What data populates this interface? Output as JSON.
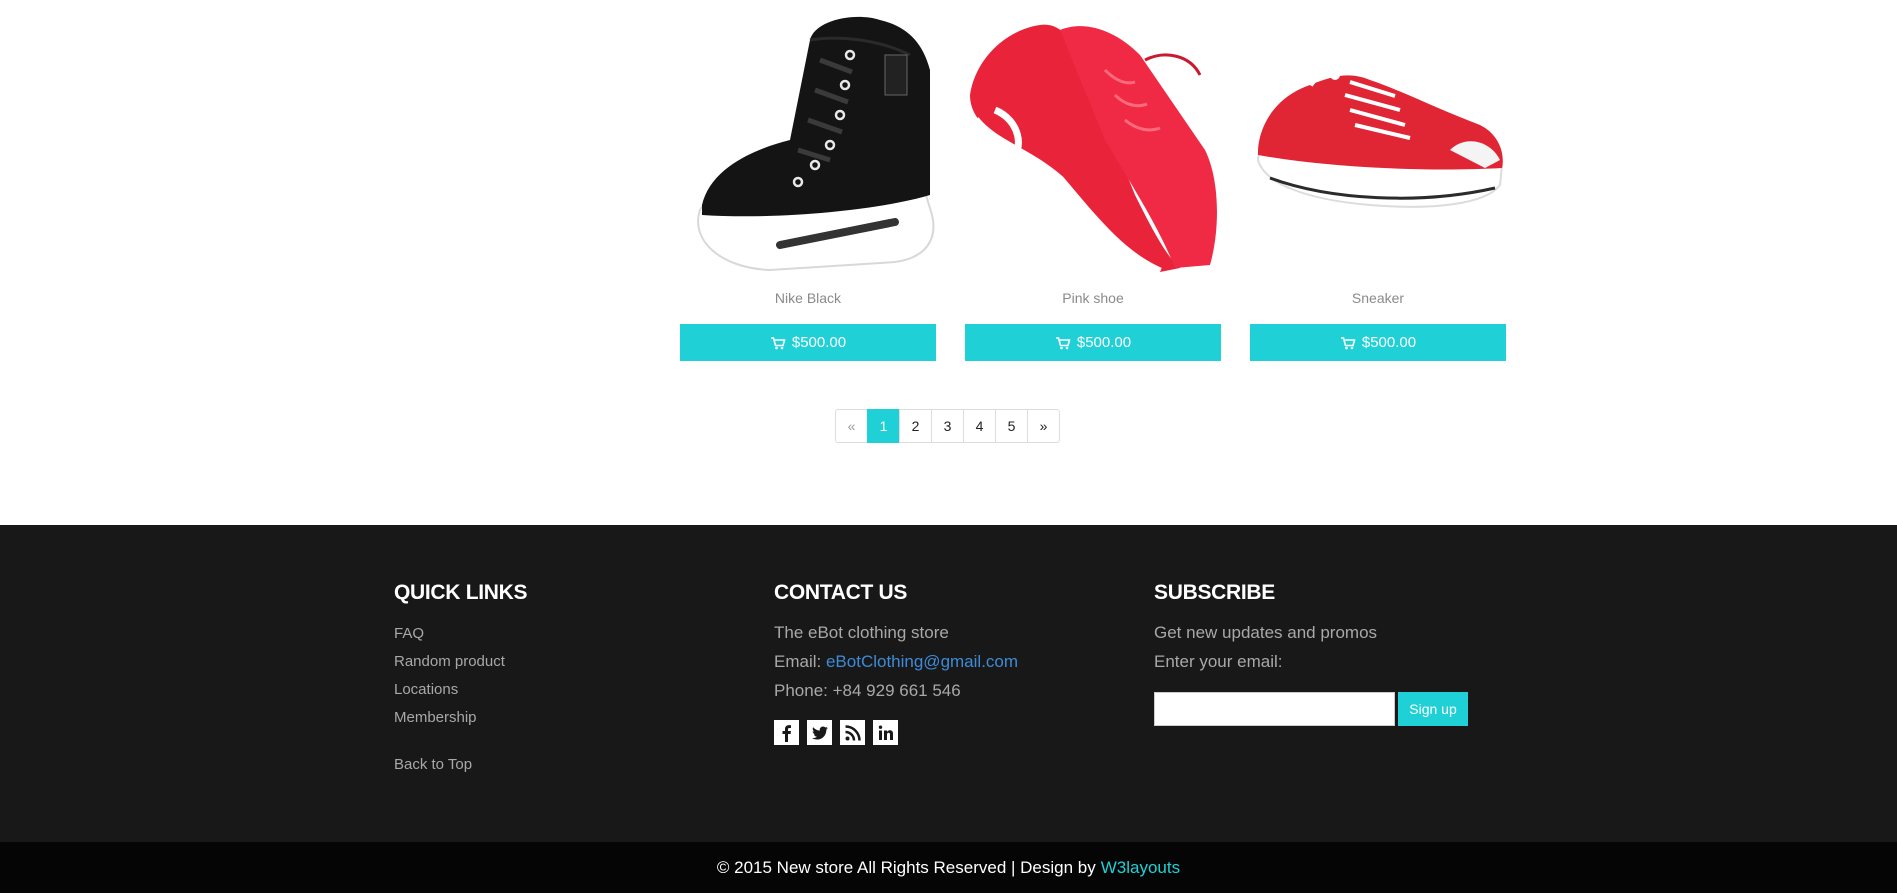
{
  "products": [
    {
      "name": "Nike Black",
      "price": "$500.00",
      "icon": "cart-icon"
    },
    {
      "name": "Pink shoe",
      "price": "$500.00",
      "icon": "cart-icon"
    },
    {
      "name": "Sneaker",
      "price": "$500.00",
      "icon": "cart-icon"
    }
  ],
  "pagination": {
    "prev": "«",
    "pages": [
      "1",
      "2",
      "3",
      "4",
      "5"
    ],
    "active": "1",
    "next": "»"
  },
  "footer": {
    "quick_links": {
      "title": "QUICK LINKS",
      "items": [
        "FAQ",
        "Random product",
        "Locations",
        "Membership"
      ],
      "back_to_top": "Back to Top"
    },
    "contact": {
      "title": "CONTACT US",
      "store": "The eBot clothing store",
      "email_label": "Email:",
      "email": "eBotClothing@gmail.com",
      "phone": "Phone: +84 929 661 546",
      "socials": [
        "facebook-icon",
        "twitter-icon",
        "rss-icon",
        "linkedin-icon"
      ]
    },
    "subscribe": {
      "title": "SUBSCRIBE",
      "text": "Get new updates and promos",
      "email_prompt": "Enter your email:",
      "input_value": "",
      "button": "Sign up"
    }
  },
  "copyright": {
    "text": "© 2015 New store All Rights Reserved | Design by",
    "link": "W3layouts"
  },
  "colors": {
    "accent": "#1fd1d6",
    "footer_bg": "#181818",
    "bottom_bg": "#050505",
    "link_blue": "#3d8bd8"
  }
}
